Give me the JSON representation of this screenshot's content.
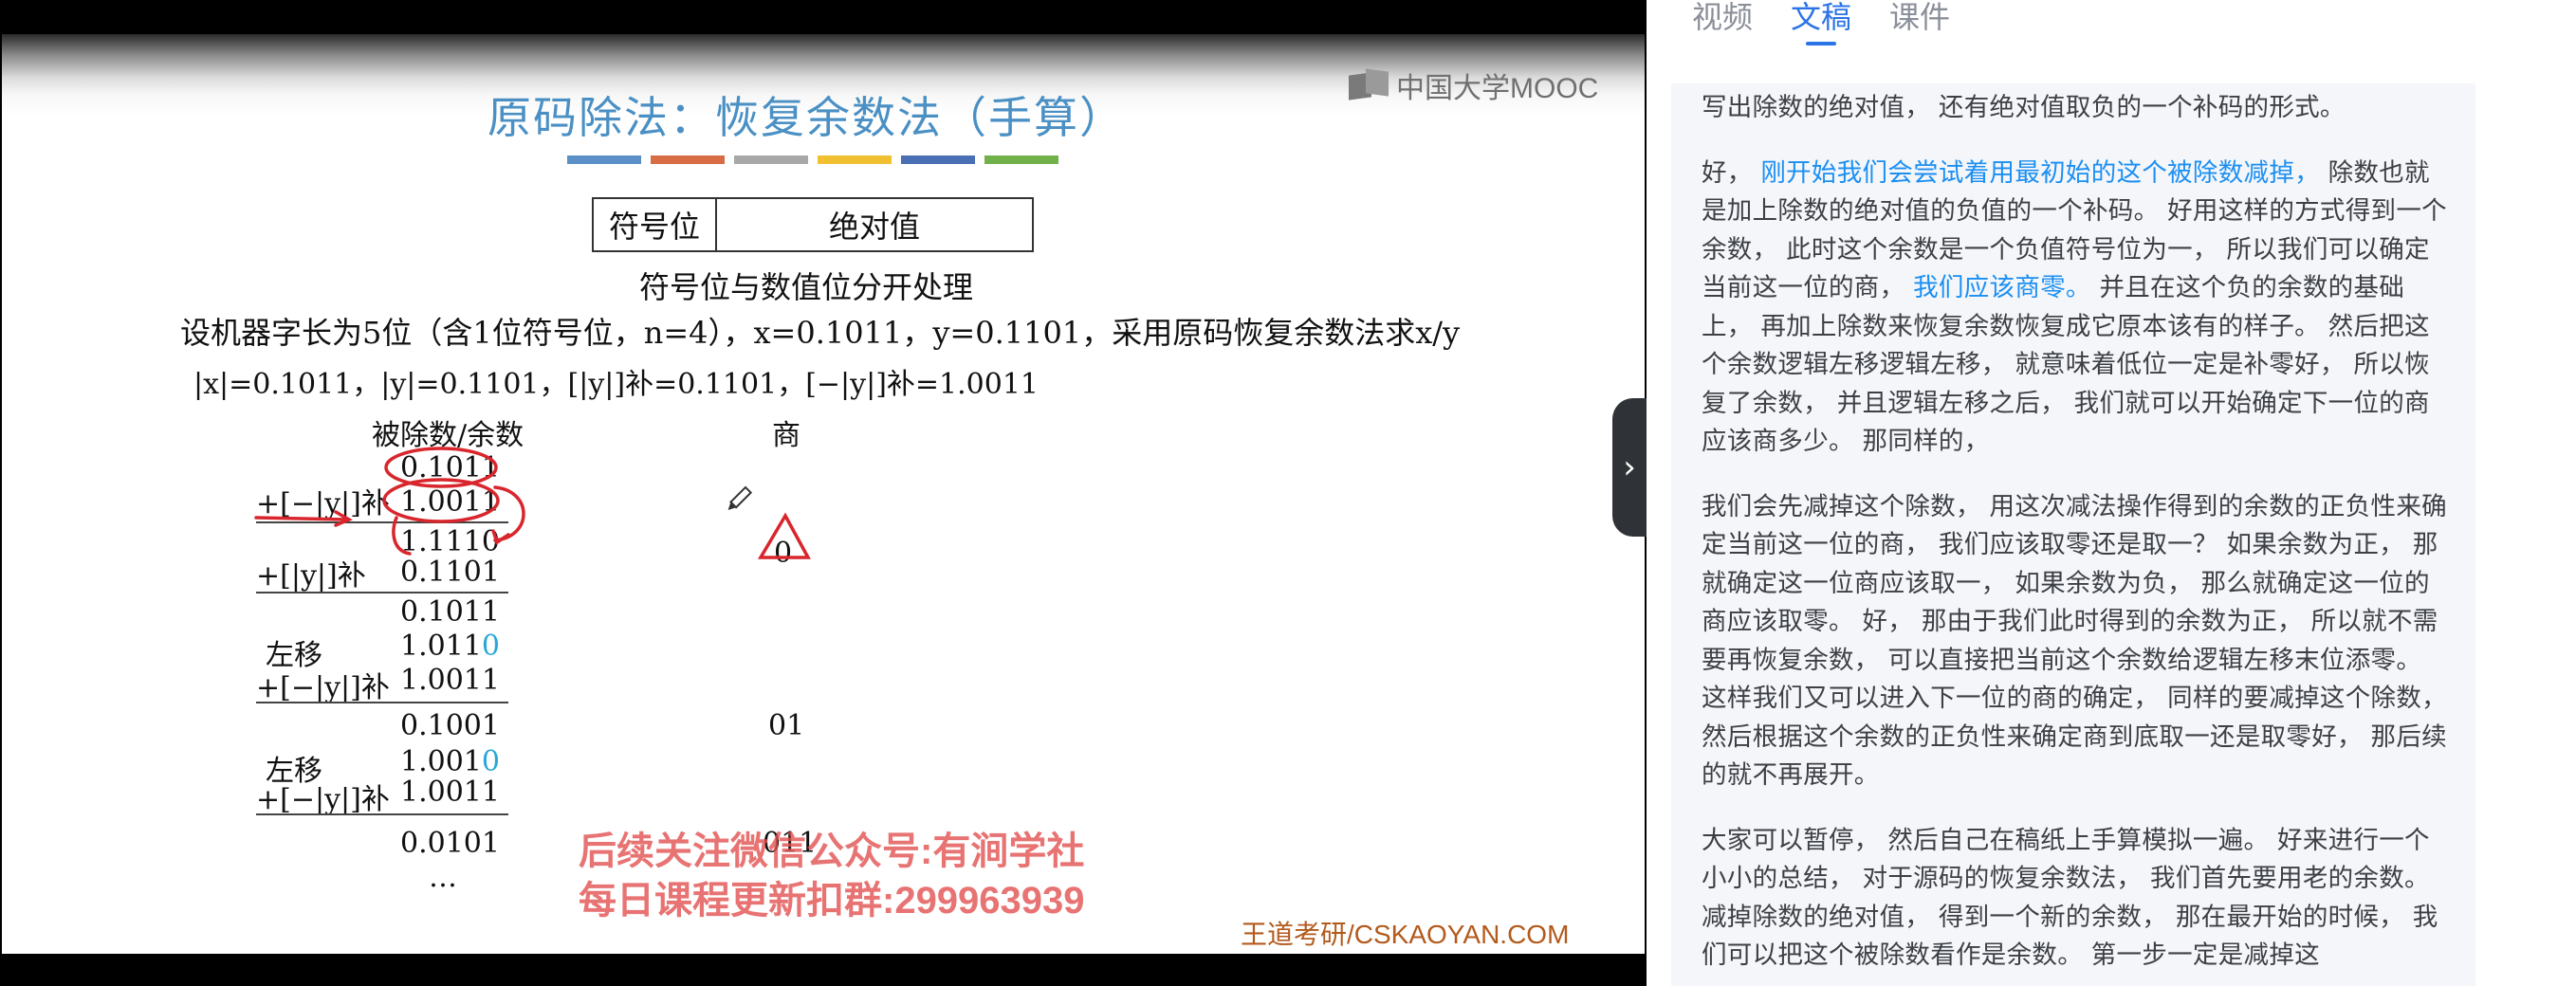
{
  "tabs": [
    {
      "label": "视频",
      "active": false
    },
    {
      "label": "文稿",
      "active": true
    },
    {
      "label": "课件",
      "active": false
    }
  ],
  "slide": {
    "logo_text": "中国大学MOOC",
    "title": "原码除法：恢复余数法（手算）",
    "color_bar": [
      "#5b8fc7",
      "#d76c45",
      "#a8a8a8",
      "#f0c030",
      "#4a6fb5",
      "#72b04a"
    ],
    "header_cell_1": "符号位",
    "header_cell_2": "绝对值",
    "note": "符号位与数值位分开处理",
    "problem": "设机器字长为5位（含1位符号位，n=4），x=0.1011，y=0.1101，采用原码恢复余数法求x/y",
    "values": "|x|=0.1011，|y|=0.1101，[|y|]补=0.1101，[−|y|]补=1.0011",
    "col_dividend": "被除数/余数",
    "col_quotient": "商",
    "rows": {
      "r1": "0.1011",
      "r2_label": "+[−|y|]补",
      "r2": "1.0011",
      "r3": "1.1110",
      "r3_q": "0",
      "r4_label": "+[|y|]补",
      "r4": "0.1101",
      "r5": "0.1011",
      "r6_label": "左移",
      "r6": "1.011",
      "r6_tail": "0",
      "r7_label": "+[−|y|]补",
      "r7": "1.0011",
      "r8": "0.1001",
      "r8_q": "01",
      "r9_label": "左移",
      "r9": "1.001",
      "r9_tail": "0",
      "r10_label": "+[−|y|]补",
      "r10": "1.0011",
      "r11": "0.0101",
      "r11_q": "011",
      "r12": "…"
    },
    "watermark_line1": "后续关注微信公众号:有涧学社",
    "watermark_line2": "每日课程更新扣群:299963939",
    "site_mark": "王道考研/CSKAOYAN.COM"
  },
  "transcript": {
    "p1": "写出除数的绝对值， 还有绝对值取负的一个补码的形式。",
    "p2_a": "好， ",
    "p2_hl1": "刚开始我们会尝试着用最初始的这个被除数减掉，",
    "p2_b": " 除数也就是加上除数的绝对值的负值的一个补码。 好用这样的方式得到一个余数， 此时这个余数是一个负值符号位为一， 所以我们可以确定当前这一位的商， ",
    "p2_hl2": "我们应该商零。",
    "p2_c": " 并且在这个负的余数的基础上， 再加上除数来恢复余数恢复成它原本该有的样子。 然后把这个余数逻辑左移逻辑左移， 就意味着低位一定是补零好， 所以恢复了余数， 并且逻辑左移之后， 我们就可以开始确定下一位的商应该商多少。 那同样的，",
    "p3": "我们会先减掉这个除数， 用这次减法操作得到的余数的正负性来确定当前这一位的商， 我们应该取零还是取一？ 如果余数为正， 那就确定这一位商应该取一， 如果余数为负， 那么就确定这一位的商应该取零。 好， 那由于我们此时得到的余数为正， 所以就不需要再恢复余数， 可以直接把当前这个余数给逻辑左移末位添零。 这样我们又可以进入下一位的商的确定， 同样的要减掉这个除数， 然后根据这个余数的正负性来确定商到底取一还是取零好， 那后续的就不再展开。",
    "p4": "大家可以暂停， 然后自己在稿纸上手算模拟一遍。 好来进行一个小小的总结， 对于源码的恢复余数法， 我们首先要用老的余数。 减掉除数的绝对值， 得到一个新的余数， 那在最开始的时候， 我们可以把这个被除数看作是余数。 第一步一定是减掉这"
  },
  "icons": {
    "collapse": "chevron-right-icon",
    "pen_cursor": "pencil-icon",
    "logo": "mooc-logo-icon"
  }
}
